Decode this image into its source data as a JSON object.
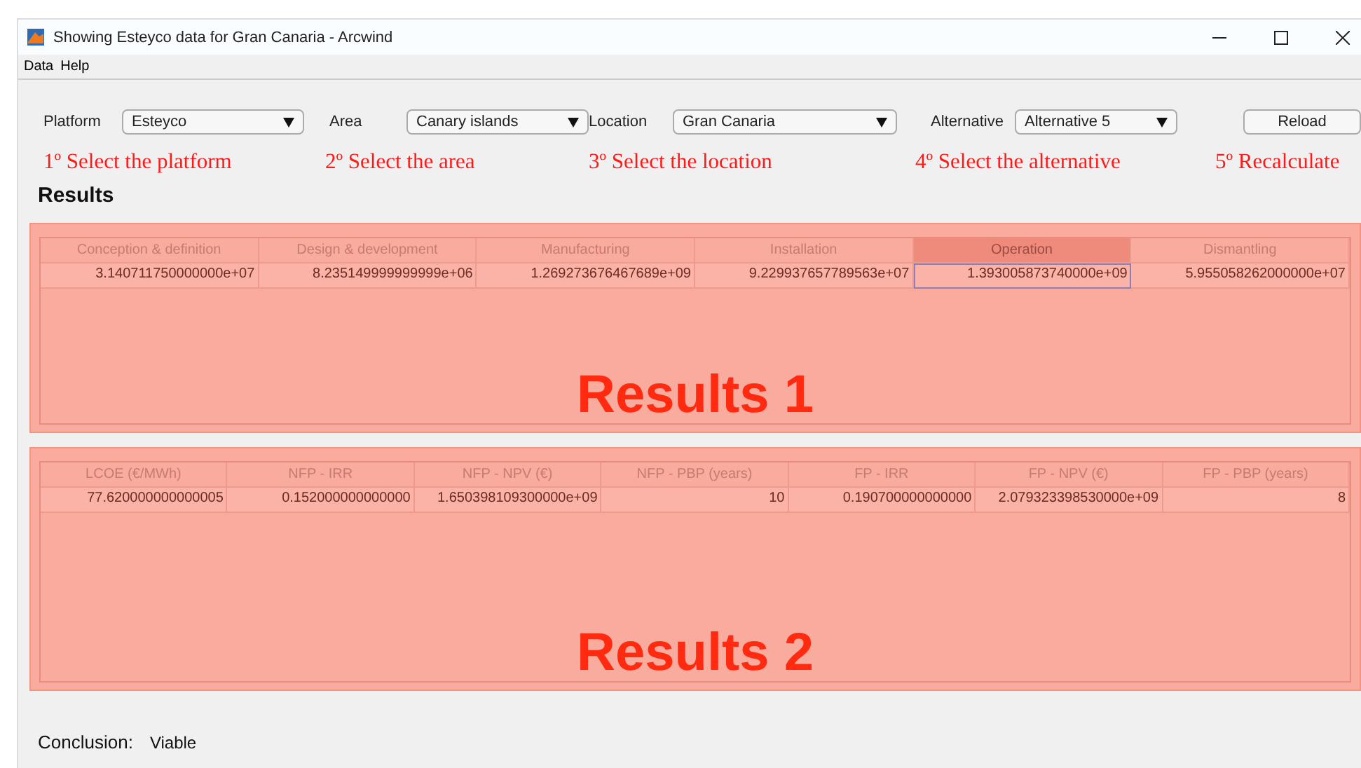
{
  "window": {
    "title": "Showing Esteyco data for Gran Canaria - Arcwind"
  },
  "menu": [
    "Data",
    "Help"
  ],
  "selectors": [
    {
      "label": "Platform",
      "value": "Esteyco",
      "hint": "1º Select the platform"
    },
    {
      "label": "Area",
      "value": "Canary islands",
      "hint": "2º Select the area"
    },
    {
      "label": "Location",
      "value": "Gran Canaria",
      "hint": "3º Select the location"
    },
    {
      "label": "Alternative",
      "value": "Alternative 5",
      "hint": "4º Select the alternative"
    }
  ],
  "reload": {
    "label": "Reload",
    "hint": "5º Recalculate"
  },
  "results_title": "Results",
  "tables": [
    {
      "overlay": "Results 1",
      "columns": [
        {
          "label": "Conception & definition",
          "selected": false
        },
        {
          "label": "Design & development",
          "selected": false
        },
        {
          "label": "Manufacturing",
          "selected": false
        },
        {
          "label": "Installation",
          "selected": false
        },
        {
          "label": "Operation",
          "selected": true
        },
        {
          "label": "Dismantling",
          "selected": false
        }
      ],
      "rows": [
        [
          "3.140711750000000e+07",
          "8.235149999999999e+06",
          "1.269273676467689e+09",
          "9.229937657789563e+07",
          "1.393005873740000e+09",
          "5.955058262000000e+07"
        ]
      ]
    },
    {
      "overlay": "Results 2",
      "columns": [
        {
          "label": "LCOE (€/MWh)",
          "selected": false
        },
        {
          "label": "NFP - IRR",
          "selected": false
        },
        {
          "label": "NFP - NPV (€)",
          "selected": false
        },
        {
          "label": "NFP - PBP (years)",
          "selected": false
        },
        {
          "label": "FP - IRR",
          "selected": false
        },
        {
          "label": "FP - NPV (€)",
          "selected": false
        },
        {
          "label": "FP - PBP (years)",
          "selected": false
        }
      ],
      "rows": [
        [
          "77.620000000000005",
          "0.152000000000000",
          "1.650398109300000e+09",
          "10",
          "0.190700000000000",
          "2.079323398530000e+09",
          "8"
        ]
      ]
    }
  ],
  "conclusion": {
    "label": "Conclusion:",
    "value": "Viable"
  }
}
